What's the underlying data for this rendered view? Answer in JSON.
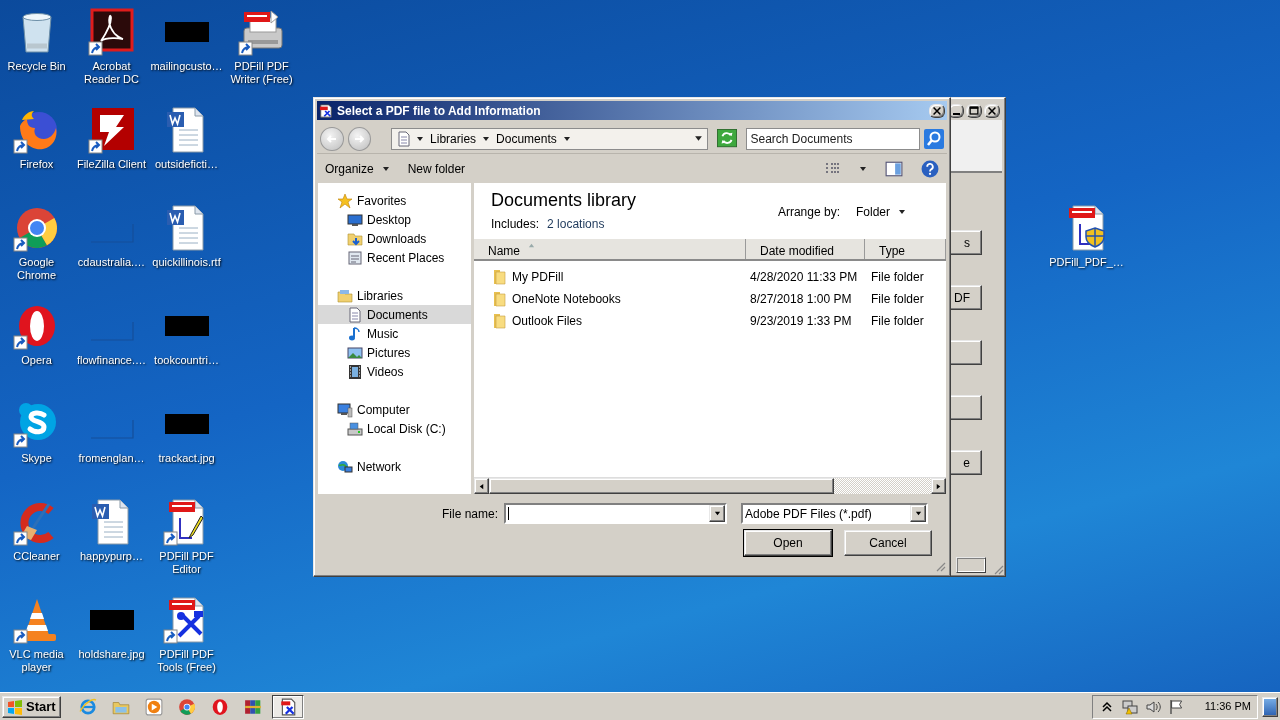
{
  "desktop_icons": [
    {
      "label": "Recycle Bin",
      "kind": "recycle",
      "shortcut": false
    },
    {
      "label": "Firefox",
      "kind": "firefox",
      "shortcut": true
    },
    {
      "label": "Google Chrome",
      "kind": "chrome",
      "shortcut": true
    },
    {
      "label": "Opera",
      "kind": "opera",
      "shortcut": true
    },
    {
      "label": "Skype",
      "kind": "skype",
      "shortcut": true
    },
    {
      "label": "CCleaner",
      "kind": "ccleaner",
      "shortcut": true
    },
    {
      "label": "VLC media player",
      "kind": "vlc",
      "shortcut": true
    },
    {
      "label": "Acrobat Reader DC",
      "kind": "acrobat",
      "shortcut": true
    },
    {
      "label": "FileZilla Client",
      "kind": "filezilla",
      "shortcut": true
    },
    {
      "label": "cdaustralia.…",
      "kind": "blank",
      "shortcut": false
    },
    {
      "label": "flowfinance.…",
      "kind": "blank",
      "shortcut": false
    },
    {
      "label": "fromenglan…",
      "kind": "blank",
      "shortcut": false
    },
    {
      "label": "happypurp…",
      "kind": "word",
      "shortcut": false
    },
    {
      "label": "holdshare.jpg",
      "kind": "black",
      "shortcut": false
    },
    {
      "label": "mailingcusto…",
      "kind": "black",
      "shortcut": false
    },
    {
      "label": "outsideficti…",
      "kind": "word",
      "shortcut": false
    },
    {
      "label": "quickillinois.rtf",
      "kind": "word",
      "shortcut": false
    },
    {
      "label": "tookcountri…",
      "kind": "black",
      "shortcut": false
    },
    {
      "label": "trackact.jpg",
      "kind": "black",
      "shortcut": false
    },
    {
      "label": "PDFill PDF Editor",
      "kind": "pdfill-editor",
      "shortcut": true
    },
    {
      "label": "PDFill PDF Tools (Free)",
      "kind": "pdfill-tools",
      "shortcut": true
    },
    {
      "label": "PDFill PDF Writer (Free)",
      "kind": "pdfill-writer",
      "shortcut": true
    }
  ],
  "desktop_icon_right": {
    "label": "PDFill_PDF_…",
    "kind": "pdfill-setup",
    "shortcut": false
  },
  "back_window": {
    "buttons": [
      {
        "kind": "text",
        "label": "s"
      },
      {
        "kind": "text",
        "label": "DF"
      },
      {
        "kind": "blank"
      },
      {
        "kind": "blank"
      },
      {
        "kind": "text",
        "label": "e"
      }
    ]
  },
  "dialog": {
    "title": "Select a PDF file to Add Information",
    "breadcrumbs": [
      "Libraries",
      "Documents"
    ],
    "search": {
      "placeholder": "Search Documents"
    },
    "toolbar": {
      "organize": "Organize",
      "new_folder": "New folder"
    },
    "nav": [
      {
        "label": "Favorites",
        "kind": "star",
        "selected": false,
        "children": [
          {
            "label": "Desktop",
            "kind": "desktop",
            "selected": false
          },
          {
            "label": "Downloads",
            "kind": "downloads",
            "selected": false
          },
          {
            "label": "Recent Places",
            "kind": "recent",
            "selected": false
          }
        ]
      },
      {
        "label": "Libraries",
        "kind": "library",
        "selected": false,
        "children": [
          {
            "label": "Documents",
            "kind": "documents",
            "selected": true
          },
          {
            "label": "Music",
            "kind": "music",
            "selected": false
          },
          {
            "label": "Pictures",
            "kind": "pictures",
            "selected": false
          },
          {
            "label": "Videos",
            "kind": "videos",
            "selected": false
          }
        ]
      },
      {
        "label": "Computer",
        "kind": "computer",
        "selected": false,
        "children": [
          {
            "label": "Local Disk (C:)",
            "kind": "disk",
            "selected": false
          }
        ]
      },
      {
        "label": "Network",
        "kind": "network",
        "selected": false
      }
    ],
    "library": {
      "title": "Documents library",
      "includes_label": "Includes:",
      "includes_link": "2 locations",
      "arrange_label": "Arrange by:",
      "arrange_value": "Folder"
    },
    "columns": [
      {
        "label": "Name",
        "sorted": true
      },
      {
        "label": "Date modified",
        "sorted": false
      },
      {
        "label": "Type",
        "sorted": false
      }
    ],
    "rows": [
      {
        "name": "My PDFill",
        "date": "4/28/2020 11:33 PM",
        "type": "File folder"
      },
      {
        "name": "OneNote Notebooks",
        "date": "8/27/2018 1:00 PM",
        "type": "File folder"
      },
      {
        "name": "Outlook Files",
        "date": "9/23/2019 1:33 PM",
        "type": "File folder"
      }
    ],
    "file_name_label": "File name:",
    "file_type": "Adobe PDF Files (*.pdf)",
    "buttons": [
      {
        "label": "Open",
        "default": true
      },
      {
        "label": "Cancel",
        "default": false
      }
    ]
  },
  "taskbar": {
    "start": "Start",
    "quick_launch": [
      {
        "kind": "ie"
      },
      {
        "kind": "explorer"
      },
      {
        "kind": "media"
      },
      {
        "kind": "chrome"
      },
      {
        "kind": "opera"
      },
      {
        "kind": "winrar"
      }
    ],
    "tasks": [
      {
        "kind": "pdfill",
        "active": true
      }
    ],
    "tray": [
      {
        "kind": "chevron"
      },
      {
        "kind": "network"
      },
      {
        "kind": "speaker"
      },
      {
        "kind": "flag"
      }
    ],
    "clock": "11:36 PM"
  }
}
